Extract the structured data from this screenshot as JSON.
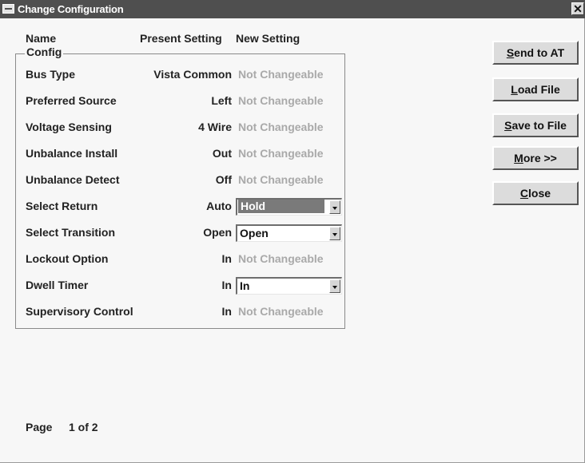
{
  "window": {
    "title": "Change Configuration",
    "close_glyph": "✕"
  },
  "header": {
    "name": "Name",
    "present": "Present Setting",
    "new": "New Setting"
  },
  "group": {
    "label": "Config"
  },
  "rows": [
    {
      "name": "Bus Type",
      "present": "Vista Common",
      "new": "Not Changeable"
    },
    {
      "name": "Preferred Source",
      "present": "Left",
      "new": "Not Changeable"
    },
    {
      "name": "Voltage Sensing",
      "present": "4 Wire",
      "new": "Not Changeable"
    },
    {
      "name": "Unbalance Install",
      "present": "Out",
      "new": "Not Changeable"
    },
    {
      "name": "Unbalance Detect",
      "present": "Off",
      "new": "Not Changeable"
    },
    {
      "name": "Select Return",
      "present": "Auto",
      "new": "Hold"
    },
    {
      "name": "Select Transition",
      "present": "Open",
      "new": "Open"
    },
    {
      "name": "Lockout Option",
      "present": "In",
      "new": "Not Changeable"
    },
    {
      "name": "Dwell Timer",
      "present": "In",
      "new": "In"
    },
    {
      "name": "Supervisory Control",
      "present": "In",
      "new": "Not Changeable"
    }
  ],
  "buttons": {
    "send": {
      "mnemonic": "S",
      "rest": "end to AT"
    },
    "load": {
      "mnemonic": "L",
      "rest": "oad File"
    },
    "save": {
      "mnemonic": "S",
      "rest": "ave to File"
    },
    "more": {
      "mnemonic": "M",
      "rest": "ore >>"
    },
    "close": {
      "mnemonic": "C",
      "rest": "lose"
    }
  },
  "page": {
    "label": "Page",
    "value": "1 of 2"
  },
  "colors": {
    "titlebar": "#4f4f4f",
    "disabled_text": "#a9a9a9",
    "selection": "#7a7a7a"
  },
  "icons": {
    "system_menu": "window-menu-icon",
    "close": "close-icon",
    "dropdown": "chevron-down-icon"
  }
}
